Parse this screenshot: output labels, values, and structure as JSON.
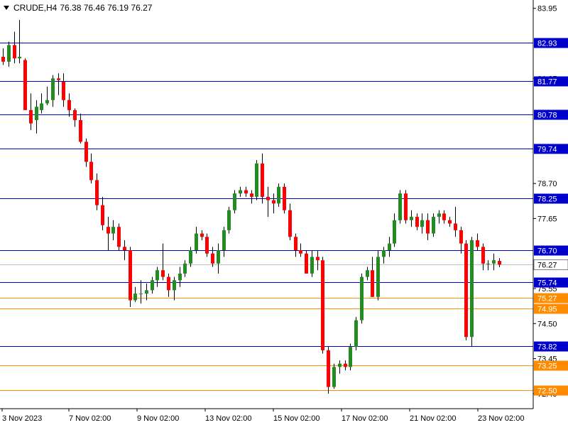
{
  "header": {
    "symbol": "CRUDE,H4",
    "ohlc": "76.38 76.46 76.19 76.27"
  },
  "colors": {
    "bull": "#228b22",
    "bear": "#ff0000",
    "wick": "#000000",
    "level_blue": "#0000cd",
    "level_orange": "#ff8c00",
    "current": "#c0c0c0"
  },
  "chart_data": {
    "type": "candlestick",
    "title": "CRUDE,H4",
    "ylim": [
      71.95,
      84.2
    ],
    "y_ticks": [
      "83.95",
      "81.85",
      "78.70",
      "77.65",
      "75.55",
      "74.50",
      "73.45",
      "72.40"
    ],
    "x_ticks": [
      "3 Nov 2023",
      "7 Nov 02:00",
      "9 Nov 02:00",
      "13 Nov 02:00",
      "15 Nov 02:00",
      "17 Nov 02:00",
      "21 Nov 02:00",
      "23 Nov 02:00"
    ],
    "levels": [
      {
        "value": 82.93,
        "label": "82.93",
        "color": "blue"
      },
      {
        "value": 81.77,
        "label": "81.77",
        "color": "blue"
      },
      {
        "value": 80.78,
        "label": "80.78",
        "color": "blue"
      },
      {
        "value": 79.74,
        "label": "79.74",
        "color": "blue"
      },
      {
        "value": 78.25,
        "label": "78.25",
        "color": "blue"
      },
      {
        "value": 76.7,
        "label": "76.70",
        "color": "blue"
      },
      {
        "value": 75.74,
        "label": "75.74",
        "color": "blue"
      },
      {
        "value": 75.27,
        "label": "75.27",
        "color": "orange"
      },
      {
        "value": 74.95,
        "label": "74.95",
        "color": "orange"
      },
      {
        "value": 73.82,
        "label": "73.82",
        "color": "blue"
      },
      {
        "value": 73.25,
        "label": "73.25",
        "color": "orange"
      },
      {
        "value": 72.5,
        "label": "72.50",
        "color": "orange"
      }
    ],
    "current_price": {
      "value": 76.27,
      "label": "76.27"
    },
    "candles": [
      [
        82.5,
        82.75,
        82.25,
        82.35
      ],
      [
        82.35,
        82.95,
        82.2,
        82.85
      ],
      [
        82.85,
        83.25,
        82.3,
        82.45
      ],
      [
        82.45,
        83.6,
        82.3,
        82.5
      ],
      [
        82.4,
        82.45,
        81.0,
        80.9
      ],
      [
        80.9,
        81.4,
        80.3,
        80.5
      ],
      [
        80.6,
        81.2,
        80.2,
        81.0
      ],
      [
        80.9,
        81.4,
        80.8,
        81.1
      ],
      [
        81.1,
        81.6,
        81.05,
        81.2
      ],
      [
        81.2,
        81.95,
        81.0,
        81.85
      ],
      [
        81.85,
        82.0,
        81.35,
        81.8
      ],
      [
        81.75,
        82.0,
        81.0,
        81.2
      ],
      [
        81.2,
        81.4,
        80.7,
        80.9
      ],
      [
        80.9,
        80.95,
        80.4,
        80.6
      ],
      [
        80.6,
        80.8,
        79.9,
        79.95
      ],
      [
        79.95,
        80.05,
        79.2,
        79.35
      ],
      [
        79.35,
        79.6,
        78.7,
        78.8
      ],
      [
        78.8,
        79.0,
        77.9,
        78.05
      ],
      [
        78.05,
        78.3,
        77.3,
        77.45
      ],
      [
        77.4,
        77.7,
        76.7,
        77.2
      ],
      [
        77.2,
        77.6,
        77.0,
        77.4
      ],
      [
        77.4,
        77.5,
        76.7,
        76.8
      ],
      [
        76.8,
        77.0,
        76.4,
        76.7
      ],
      [
        76.7,
        76.8,
        75.0,
        75.2
      ],
      [
        75.2,
        75.6,
        75.15,
        75.4
      ],
      [
        75.4,
        75.8,
        75.1,
        75.4
      ],
      [
        75.4,
        75.7,
        75.2,
        75.5
      ],
      [
        75.5,
        75.9,
        75.4,
        75.8
      ],
      [
        75.8,
        76.2,
        75.6,
        76.1
      ],
      [
        76.1,
        76.9,
        75.8,
        75.9
      ],
      [
        75.9,
        76.0,
        75.3,
        75.5
      ],
      [
        75.5,
        75.9,
        75.2,
        75.8
      ],
      [
        75.8,
        76.2,
        75.6,
        76.0
      ],
      [
        76.0,
        76.4,
        75.9,
        76.3
      ],
      [
        76.3,
        76.8,
        76.2,
        76.7
      ],
      [
        76.7,
        77.4,
        76.6,
        77.2
      ],
      [
        77.2,
        77.3,
        77.0,
        77.1
      ],
      [
        77.1,
        77.2,
        76.5,
        76.6
      ],
      [
        76.6,
        76.8,
        76.2,
        76.3
      ],
      [
        76.3,
        76.9,
        76.0,
        76.7
      ],
      [
        76.7,
        77.4,
        76.5,
        77.3
      ],
      [
        77.3,
        78.0,
        77.2,
        77.9
      ],
      [
        77.9,
        78.5,
        77.8,
        78.4
      ],
      [
        78.4,
        78.6,
        78.3,
        78.5
      ],
      [
        78.5,
        78.6,
        78.3,
        78.4
      ],
      [
        78.4,
        78.5,
        78.1,
        78.3
      ],
      [
        78.3,
        79.4,
        78.2,
        79.3
      ],
      [
        79.3,
        79.6,
        78.1,
        78.3
      ],
      [
        78.3,
        78.6,
        77.7,
        78.2
      ],
      [
        78.2,
        78.4,
        77.8,
        78.1
      ],
      [
        78.1,
        78.7,
        78.0,
        78.6
      ],
      [
        78.6,
        78.7,
        77.8,
        77.9
      ],
      [
        77.9,
        78.1,
        77.0,
        77.1
      ],
      [
        77.1,
        77.2,
        76.5,
        76.7
      ],
      [
        76.7,
        76.9,
        76.5,
        76.6
      ],
      [
        76.6,
        76.7,
        76.0,
        76.0
      ],
      [
        76.0,
        76.7,
        75.9,
        76.5
      ],
      [
        76.5,
        76.7,
        76.1,
        76.4
      ],
      [
        76.4,
        76.5,
        73.6,
        73.7
      ],
      [
        73.7,
        73.8,
        72.4,
        72.6
      ],
      [
        72.6,
        73.3,
        72.55,
        73.2
      ],
      [
        73.2,
        73.4,
        73.0,
        73.3
      ],
      [
        73.3,
        73.4,
        73.1,
        73.2
      ],
      [
        73.2,
        73.9,
        73.1,
        73.8
      ],
      [
        73.8,
        74.7,
        73.7,
        74.6
      ],
      [
        74.6,
        76.0,
        74.5,
        75.9
      ],
      [
        75.9,
        76.2,
        75.8,
        76.1
      ],
      [
        76.1,
        76.5,
        75.3,
        75.3
      ],
      [
        75.3,
        76.7,
        75.2,
        76.5
      ],
      [
        76.5,
        76.8,
        76.3,
        76.7
      ],
      [
        76.7,
        77.1,
        76.5,
        76.9
      ],
      [
        76.9,
        77.8,
        76.8,
        77.6
      ],
      [
        77.6,
        78.5,
        77.5,
        78.4
      ],
      [
        78.4,
        78.5,
        77.5,
        77.6
      ],
      [
        77.6,
        77.9,
        77.4,
        77.7
      ],
      [
        77.7,
        77.8,
        77.3,
        77.4
      ],
      [
        77.4,
        77.8,
        77.2,
        77.6
      ],
      [
        77.6,
        77.8,
        77.0,
        77.2
      ],
      [
        77.2,
        77.8,
        77.1,
        77.7
      ],
      [
        77.7,
        77.9,
        77.5,
        77.8
      ],
      [
        77.8,
        77.9,
        77.5,
        77.6
      ],
      [
        77.6,
        77.7,
        77.4,
        77.5
      ],
      [
        77.5,
        78.0,
        77.1,
        77.3
      ],
      [
        77.3,
        77.4,
        76.6,
        76.9
      ],
      [
        76.9,
        77.0,
        74.0,
        74.1
      ],
      [
        74.1,
        77.1,
        73.8,
        77.0
      ],
      [
        77.0,
        77.2,
        76.7,
        76.8
      ],
      [
        76.8,
        76.9,
        76.1,
        76.3
      ],
      [
        76.3,
        76.4,
        76.1,
        76.3
      ],
      [
        76.3,
        76.6,
        76.1,
        76.4
      ],
      [
        76.38,
        76.46,
        76.19,
        76.27
      ]
    ]
  }
}
